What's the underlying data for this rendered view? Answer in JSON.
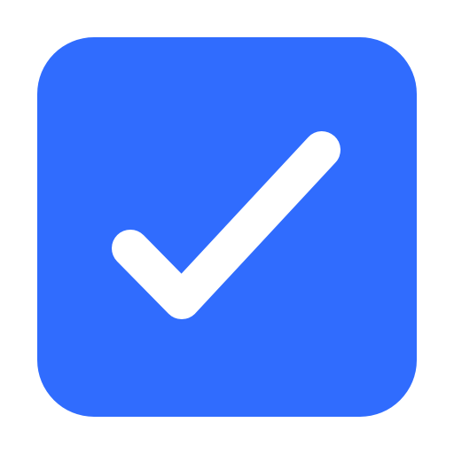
{
  "checkbox": {
    "state": "checked",
    "icon": "checkmark-icon"
  },
  "colors": {
    "background": "#ffffff",
    "box_fill": "#306cfe",
    "check_stroke": "#ffffff"
  }
}
